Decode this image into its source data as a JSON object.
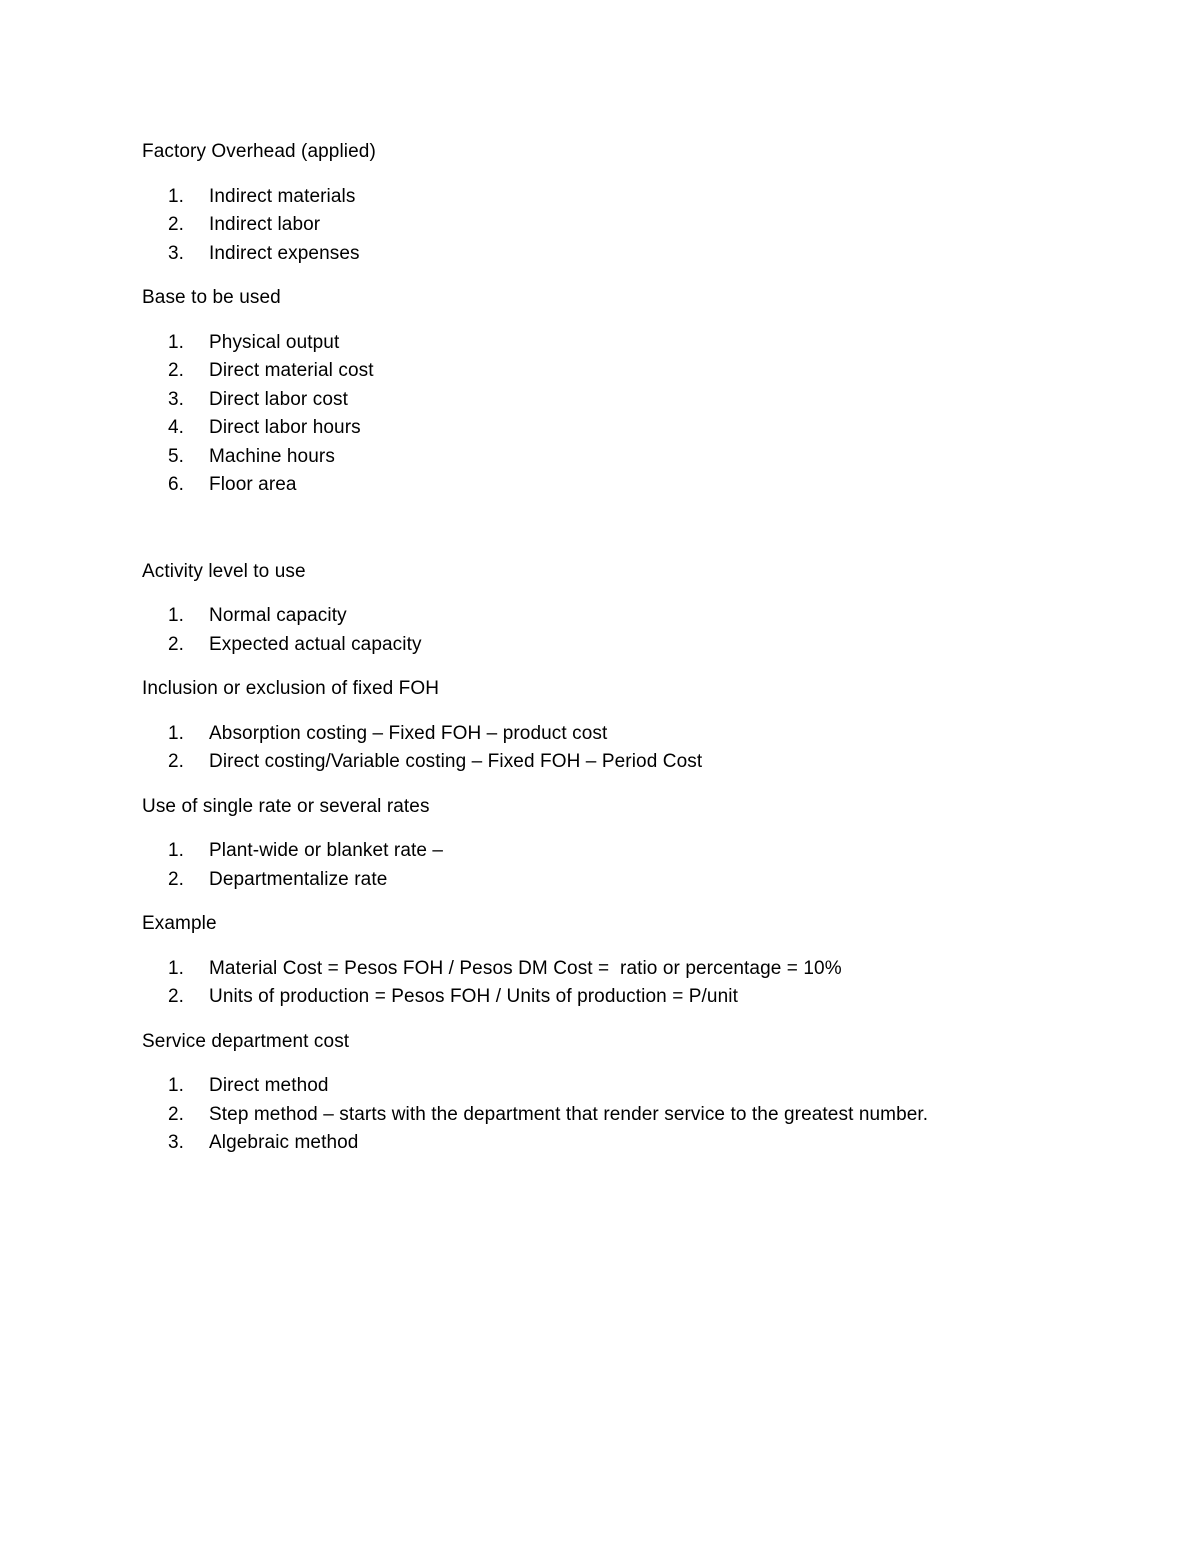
{
  "document": {
    "page_background": "#ffffff",
    "text_color": "#000000",
    "sections": [
      {
        "heading": "Factory Overhead (applied)",
        "items": [
          {
            "num": "1.",
            "text": "Indirect materials"
          },
          {
            "num": "2.",
            "text": "Indirect labor"
          },
          {
            "num": "3.",
            "text": "Indirect expenses"
          }
        ]
      },
      {
        "heading": "Base to be used",
        "items": [
          {
            "num": "1.",
            "text": "Physical output"
          },
          {
            "num": "2.",
            "text": "Direct material cost"
          },
          {
            "num": "3.",
            "text": "Direct labor cost"
          },
          {
            "num": "4.",
            "text": "Direct labor hours"
          },
          {
            "num": "5.",
            "text": "Machine hours"
          },
          {
            "num": "6.",
            "text": "Floor area"
          }
        ]
      },
      {
        "heading": "Activity level to use",
        "items": [
          {
            "num": "1.",
            "text": "Normal capacity"
          },
          {
            "num": "2.",
            "text": "Expected actual capacity"
          }
        ]
      },
      {
        "heading": "Inclusion or exclusion of fixed FOH",
        "items": [
          {
            "num": "1.",
            "text": "Absorption costing – Fixed FOH – product cost"
          },
          {
            "num": "2.",
            "text": "Direct costing/Variable costing – Fixed FOH – Period Cost"
          }
        ]
      },
      {
        "heading": "Use of single rate or several rates",
        "items": [
          {
            "num": "1.",
            "text": "Plant-wide or blanket rate –"
          },
          {
            "num": "2.",
            "text": "Departmentalize rate"
          }
        ]
      },
      {
        "heading": "Example",
        "items": [
          {
            "num": "1.",
            "text": "Material Cost = Pesos FOH / Pesos DM Cost =  ratio or percentage = 10%"
          },
          {
            "num": "2.",
            "text": "Units of production = Pesos FOH / Units of production = P/unit"
          }
        ]
      },
      {
        "heading": "Service department cost",
        "items": [
          {
            "num": "1.",
            "text": "Direct method"
          },
          {
            "num": "2.",
            "text": "Step method – starts with the department that render service to the greatest number."
          },
          {
            "num": "3.",
            "text": "Algebraic method"
          }
        ]
      }
    ]
  }
}
